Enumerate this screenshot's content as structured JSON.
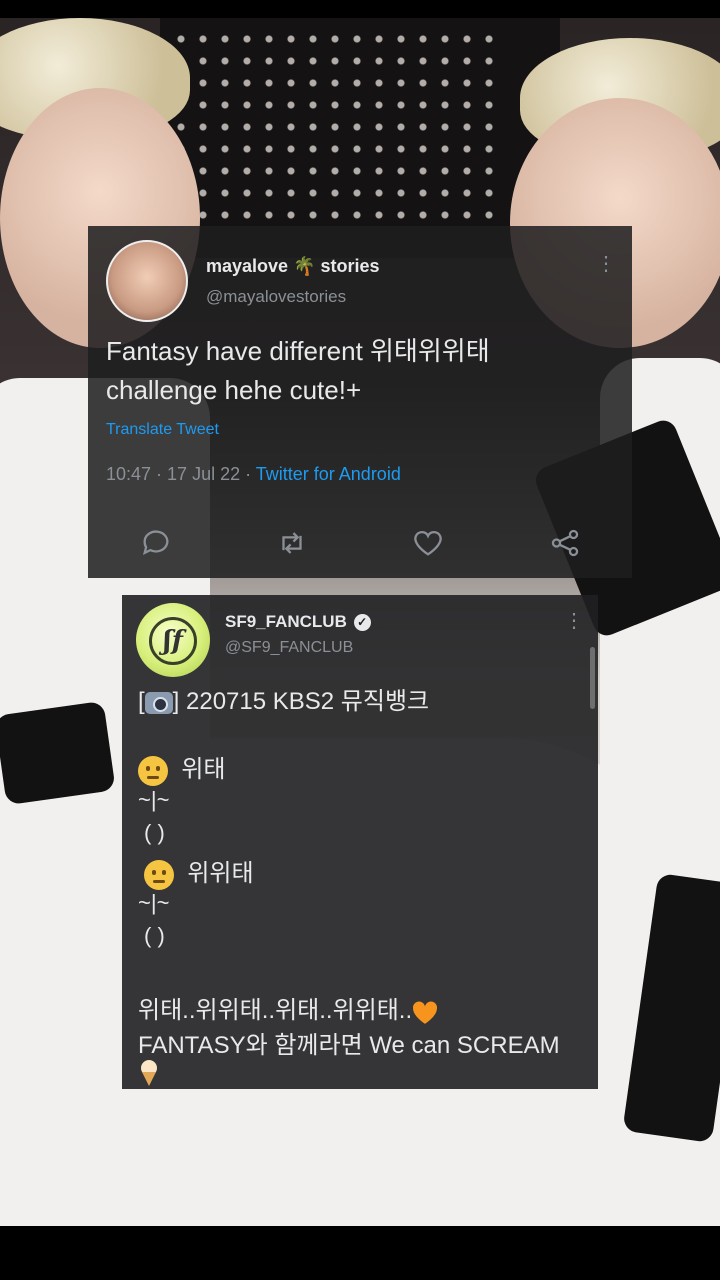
{
  "tweet1": {
    "name": "mayalove 🌴 stories",
    "handle": "@mayalovestories",
    "text_line1": "Fantasy have different 위태위위태",
    "text_line2": "challenge hehe cute!+",
    "translate": "Translate Tweet",
    "time": "10:47 · 17 Jul 22 · ",
    "source": "Twitter for Android"
  },
  "tweet2": {
    "name": "SF9_FANCLUB",
    "handle": "@SF9_FANCLUB",
    "logo": "ʃf",
    "line1_open": "[",
    "line1_rest": "] 220715 KBS2 뮤직뱅크",
    "line2": "위태",
    "line3": "~|~",
    "line4": "( )",
    "line5": "위위태",
    "line6": "~|~",
    "line7": "( )",
    "line8": "위태..위위태..위태..위위태..",
    "line9": "FANTASY와 함께라면 We can SCREAM"
  },
  "colors": {
    "link": "#1d9bf0",
    "verified": "#e7e9ea",
    "heart": "#f7941d"
  }
}
